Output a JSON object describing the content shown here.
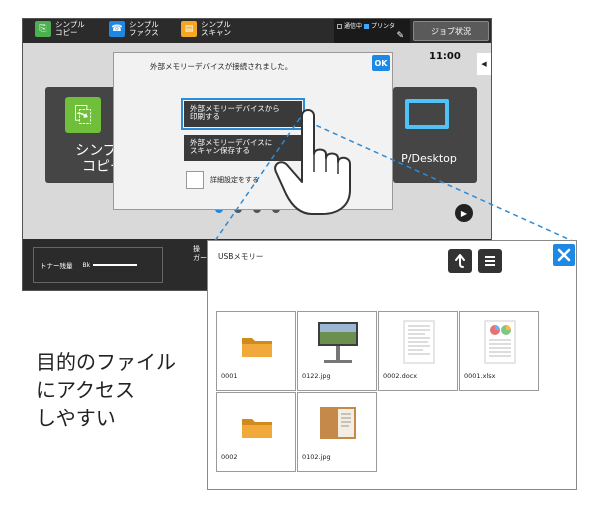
{
  "topbar": {
    "modes": [
      {
        "label_line1": "シンプル",
        "label_line2": "コピー",
        "icon": "copy-icon"
      },
      {
        "label_line1": "シンプル",
        "label_line2": "ファクス",
        "icon": "fax-icon"
      },
      {
        "label_line1": "シンプル",
        "label_line2": "スキャン",
        "icon": "scan-icon"
      }
    ],
    "status": {
      "comm": "通信中",
      "printer": "プリンタ"
    },
    "job_status_label": "ジョブ状況",
    "time": "11:00"
  },
  "home": {
    "tile_left_label": "シンプル\nコピー",
    "tile_right_label": "P/Desktop"
  },
  "bottombar": {
    "toner_label": "トナー残量",
    "toner_level": "Bk",
    "guide_label": "操\nガー"
  },
  "dialog": {
    "message": "外部メモリーデバイスが接続されました。",
    "ok_label": "OK",
    "print_option": "外部メモリーデバイスから\n印刷する",
    "scan_option": "外部メモリーデバイスに\nスキャン保存する",
    "detail_label": "詳細設定をする"
  },
  "browser": {
    "title": "USBメモリー",
    "files": [
      {
        "name": "0001",
        "type": "folder"
      },
      {
        "name": "0122.jpg",
        "type": "image"
      },
      {
        "name": "0002.docx",
        "type": "document"
      },
      {
        "name": "0001.xlsx",
        "type": "spreadsheet"
      },
      {
        "name": "0002",
        "type": "folder"
      },
      {
        "name": "0102.jpg",
        "type": "image"
      }
    ]
  },
  "caption": {
    "line1": "目的のファイル",
    "line2": "にアクセス",
    "line3": "しやすい"
  },
  "colors": {
    "accent": "#1e88e5",
    "callout": "#2e8bd6"
  }
}
